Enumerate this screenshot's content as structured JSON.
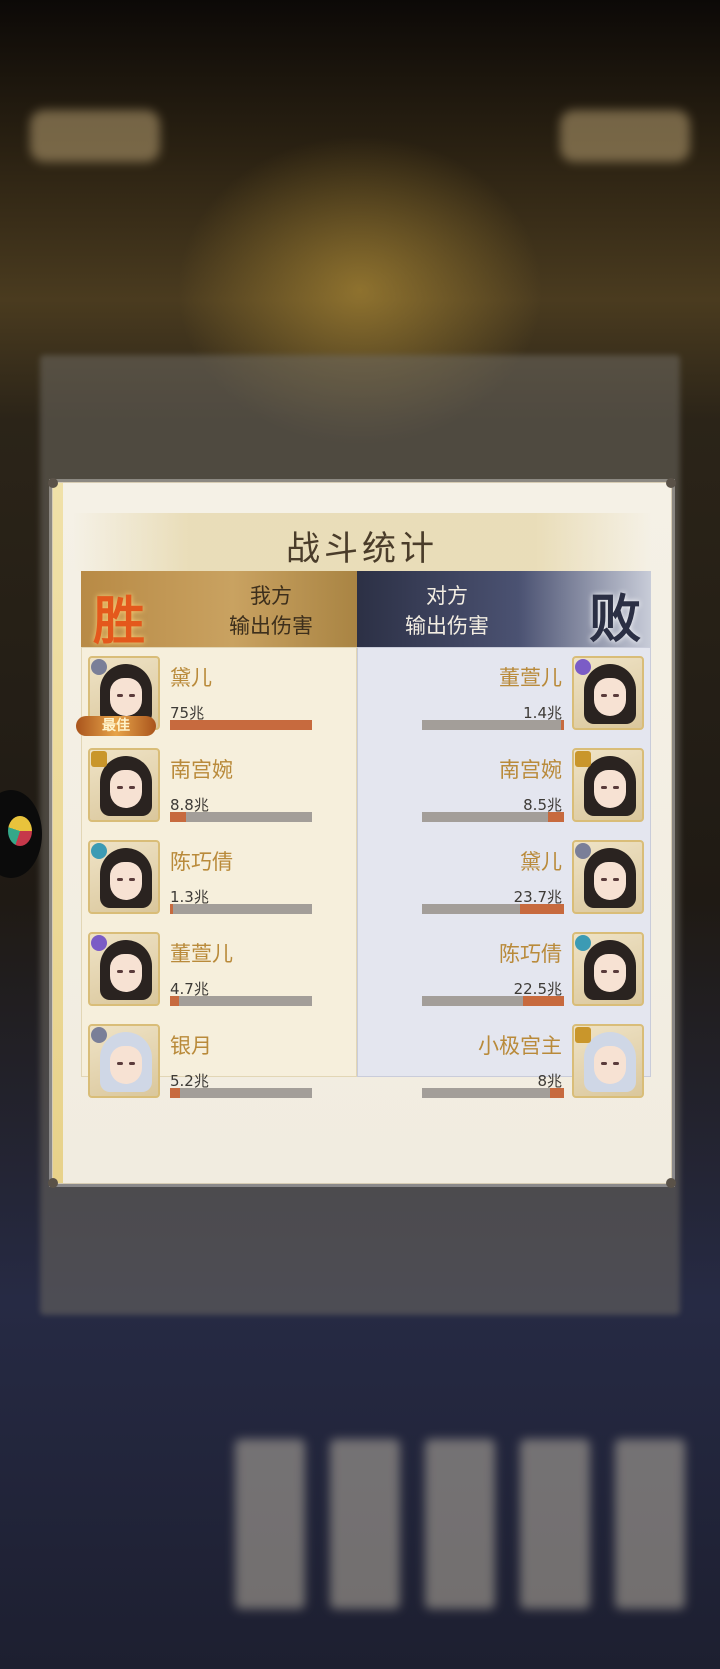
{
  "dialog": {
    "title": "战斗统计",
    "left_header": {
      "result": "胜",
      "line1": "我方",
      "line2": "输出伤害"
    },
    "right_header": {
      "result": "败",
      "line1": "对方",
      "line2": "输出伤害"
    },
    "best_badge": "最佳"
  },
  "ally": [
    {
      "name": "黛儿",
      "damage": "75兆",
      "bar_fraction": 1.0,
      "badge": "grey",
      "best": true
    },
    {
      "name": "南宫婉",
      "damage": "8.8兆",
      "bar_fraction": 0.11,
      "badge": "gold",
      "best": false
    },
    {
      "name": "陈巧倩",
      "damage": "1.3兆",
      "bar_fraction": 0.02,
      "badge": "teal",
      "best": false
    },
    {
      "name": "董萱儿",
      "damage": "4.7兆",
      "bar_fraction": 0.06,
      "badge": "purple",
      "best": false
    },
    {
      "name": "银月",
      "damage": "5.2兆",
      "bar_fraction": 0.07,
      "badge": "grey",
      "best": false
    }
  ],
  "enemy": [
    {
      "name": "董萱儿",
      "damage": "1.4兆",
      "bar_fraction": 0.02,
      "badge": "purple"
    },
    {
      "name": "南宫婉",
      "damage": "8.5兆",
      "bar_fraction": 0.11,
      "badge": "gold"
    },
    {
      "name": "黛儿",
      "damage": "23.7兆",
      "bar_fraction": 0.31,
      "badge": "grey"
    },
    {
      "name": "陈巧倩",
      "damage": "22.5兆",
      "bar_fraction": 0.29,
      "badge": "teal"
    },
    {
      "name": "小极宫主",
      "damage": "8兆",
      "bar_fraction": 0.1,
      "badge": "gold"
    }
  ],
  "colors": {
    "bar_fill": "#c76a3e",
    "bar_bg": "#a39e99",
    "name": "#b98a3a"
  }
}
